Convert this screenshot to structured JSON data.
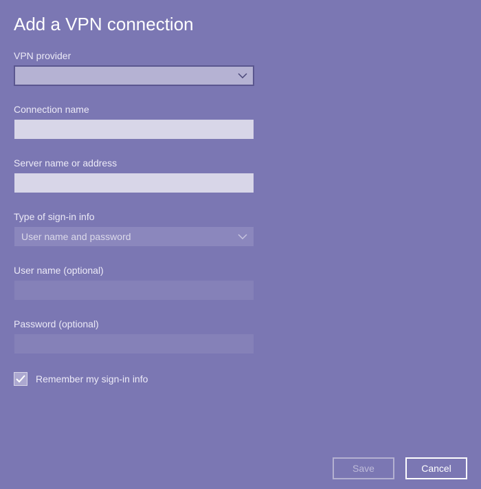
{
  "title": "Add a VPN connection",
  "fields": {
    "provider": {
      "label": "VPN provider",
      "value": ""
    },
    "connectionName": {
      "label": "Connection name",
      "value": ""
    },
    "server": {
      "label": "Server name or address",
      "value": ""
    },
    "signinType": {
      "label": "Type of sign-in info",
      "value": "User name and password"
    },
    "username": {
      "label": "User name (optional)",
      "value": ""
    },
    "password": {
      "label": "Password (optional)",
      "value": ""
    }
  },
  "checkbox": {
    "label": "Remember my sign-in info",
    "checked": true
  },
  "buttons": {
    "save": "Save",
    "cancel": "Cancel"
  }
}
